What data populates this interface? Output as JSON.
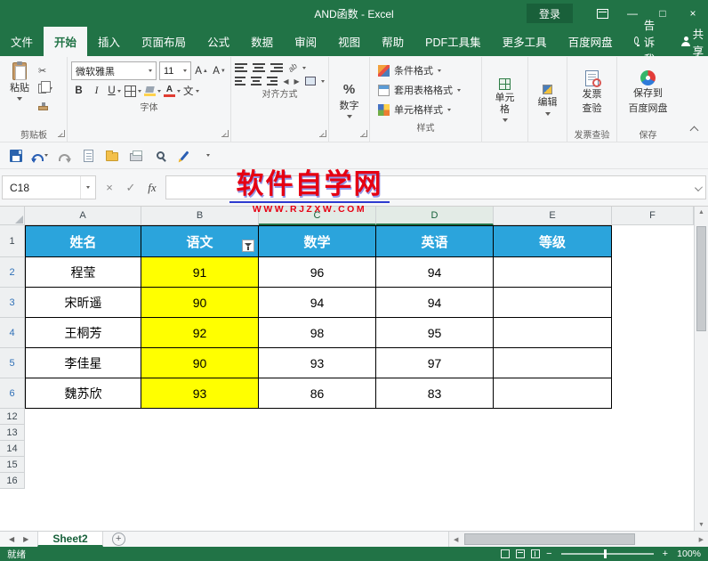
{
  "titlebar": {
    "title": "AND函数  -  Excel",
    "login": "登录"
  },
  "tabs": {
    "file": "文件",
    "items": [
      "开始",
      "插入",
      "页面布局",
      "公式",
      "数据",
      "审阅",
      "视图",
      "帮助",
      "PDF工具集",
      "更多工具",
      "百度网盘"
    ],
    "tell_me": "告诉我",
    "share": "共享"
  },
  "ribbon": {
    "paste": "粘贴",
    "clipboard_label": "剪贴板",
    "font_name": "微软雅黑",
    "font_size": "11",
    "bold": "B",
    "italic": "I",
    "underline": "U",
    "phonetic": "文",
    "font_label": "字体",
    "align_label": "对齐方式",
    "percent": "%",
    "number_label": "数字",
    "conditional_formatting": "条件格式",
    "format_as_table": "套用表格格式",
    "cell_styles": "单元格样式",
    "styles_label": "样式",
    "cells_label": "单元格",
    "editing_label": "编辑",
    "invoice_line1": "发票",
    "invoice_line2": "查验",
    "invoice_label": "发票查验",
    "save_line1": "保存到",
    "save_line2": "百度网盘",
    "save_label": "保存"
  },
  "icons": {
    "scissors": "✂",
    "letter_a": "A",
    "orientation": "ab",
    "minimize": "—",
    "maximize": "□",
    "close": "×",
    "cancel": "×",
    "check": "✓",
    "up": "▲",
    "down": "▼",
    "left": "◀",
    "right": "▶",
    "minus": "−",
    "plus": "+"
  },
  "formula": {
    "name_box": "C18",
    "fx": "fx"
  },
  "watermark": {
    "title": "软件自学网",
    "url": "WWW.RJZXW.COM"
  },
  "grid": {
    "columns": [
      "A",
      "B",
      "C",
      "D",
      "E",
      "F"
    ],
    "rows_top": [
      "1",
      "2",
      "3",
      "4",
      "5",
      "6"
    ],
    "rows_bottom": [
      "12",
      "13",
      "14",
      "15",
      "16"
    ],
    "header": [
      "姓名",
      "语文",
      "数学",
      "英语",
      "等级"
    ],
    "data": [
      [
        "程莹",
        "91",
        "96",
        "94",
        ""
      ],
      [
        "宋昕遥",
        "90",
        "94",
        "94",
        ""
      ],
      [
        "王桐芳",
        "92",
        "98",
        "95",
        ""
      ],
      [
        "李佳星",
        "90",
        "93",
        "97",
        ""
      ],
      [
        "魏苏欣",
        "93",
        "86",
        "83",
        ""
      ]
    ]
  },
  "sheetbar": {
    "tab": "Sheet2"
  },
  "statusbar": {
    "ready": "就绪",
    "zoom": "100%"
  },
  "colors": {
    "accent_green": "#217346",
    "table_header_blue": "#2BA4DC",
    "highlight_yellow": "#FFFF00",
    "watermark_red": "#E60012"
  }
}
